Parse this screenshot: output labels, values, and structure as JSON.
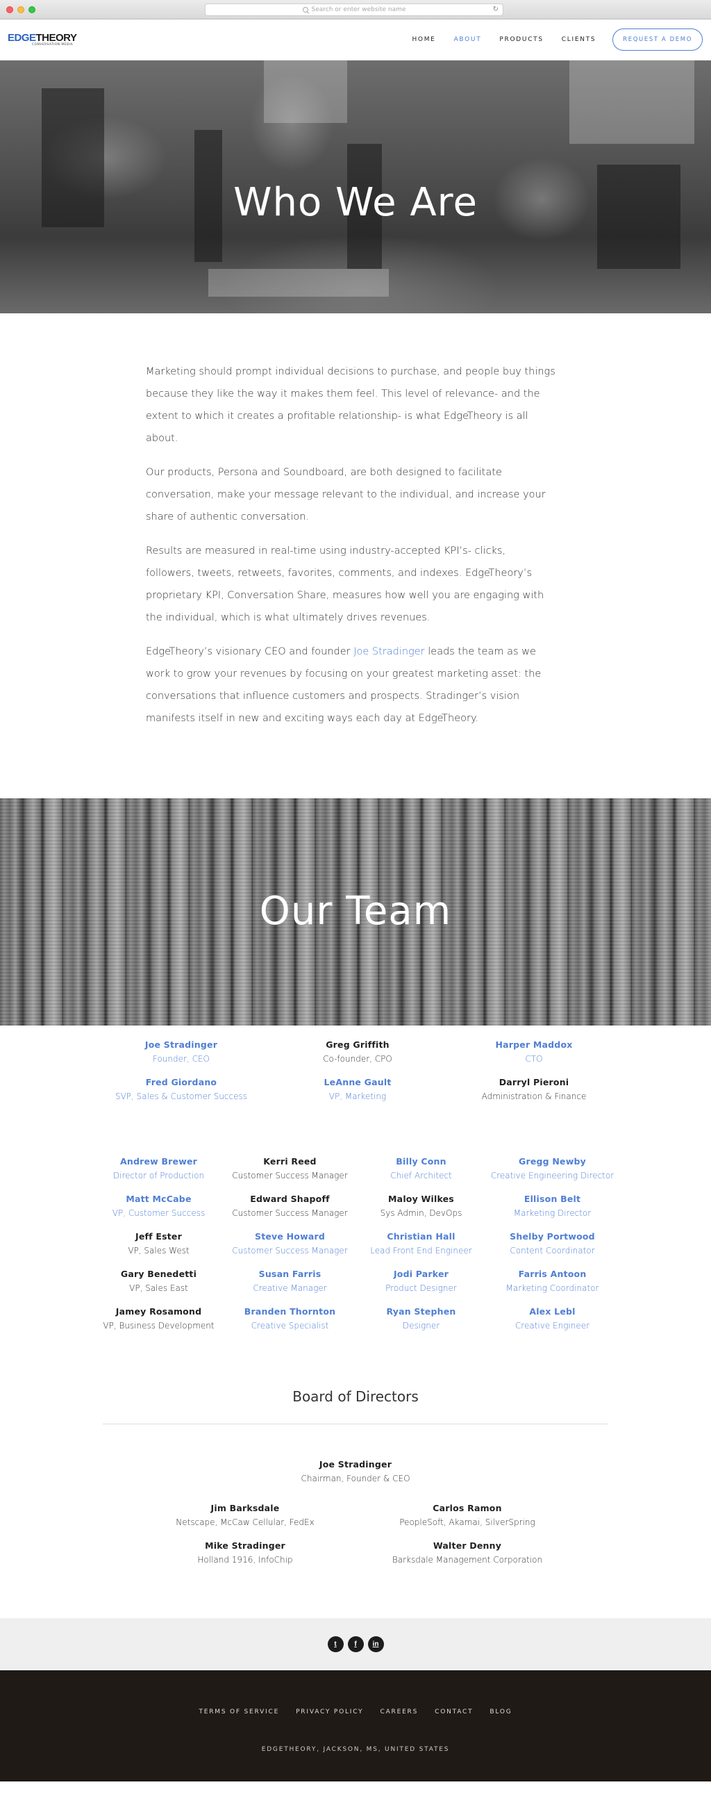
{
  "browser": {
    "url_placeholder": "Search or enter website name"
  },
  "header": {
    "logo_edge": "EDGE",
    "logo_theory": "THEORY",
    "logo_tagline": "CONVERSATION MEDIA",
    "nav": [
      {
        "label": "HOME"
      },
      {
        "label": "ABOUT"
      },
      {
        "label": "PRODUCTS"
      },
      {
        "label": "CLIENTS"
      }
    ],
    "cta": "REQUEST A DEMO"
  },
  "hero": {
    "title": "Who We Are"
  },
  "intro": {
    "p1": "Marketing should prompt individual decisions to purchase, and people buy things because they like the way it makes them feel. This level of relevance- and the extent to which it creates a profitable relationship- is what EdgeTheory is all about.",
    "p2": "Our products, Persona and Soundboard, are both designed to facilitate conversation, make your message relevant to the individual, and increase your share of authentic conversation.",
    "p3": "Results are measured in real-time using industry-accepted KPI’s- clicks, followers, tweets, retweets, favorites, comments, and indexes. EdgeTheory’s proprietary KPI, Conversation Share, measures how well you are engaging with the individual, which is what ultimately drives revenues.",
    "p4_before": "EdgeTheory’s visionary CEO and founder ",
    "p4_link": "Joe Stradinger",
    "p4_after": " leads the team as we work to grow your revenues by focusing on your greatest marketing asset: the conversations that influence customers and prospects. Stradinger’s vision manifests itself in new and exciting ways each day at EdgeTheory."
  },
  "team": {
    "title": "Our Team",
    "leaders": [
      {
        "name": "Joe Stradinger",
        "role": "Founder, CEO"
      },
      {
        "name": "Greg Griffith",
        "role": "Co-founder, CPO"
      },
      {
        "name": "Harper Maddox",
        "role": "CTO"
      },
      {
        "name": "Fred Giordano",
        "role": "SVP, Sales & Customer Success"
      },
      {
        "name": "LeAnne Gault",
        "role": "VP, Marketing"
      },
      {
        "name": "Darryl Pieroni",
        "role": "Administration & Finance"
      }
    ],
    "staff": [
      {
        "name": "Andrew Brewer",
        "role": "Director of Production"
      },
      {
        "name": "Kerri Reed",
        "role": "Customer Success Manager"
      },
      {
        "name": "Billy Conn",
        "role": "Chief Architect"
      },
      {
        "name": "Gregg Newby",
        "role": "Creative Engineering Director"
      },
      {
        "name": "Matt McCabe",
        "role": "VP, Customer Success"
      },
      {
        "name": "Edward Shapoff",
        "role": "Customer Success Manager"
      },
      {
        "name": "Maloy Wilkes",
        "role": "Sys Admin, DevOps"
      },
      {
        "name": "Ellison Belt",
        "role": "Marketing Director"
      },
      {
        "name": "Jeff Ester",
        "role": "VP, Sales West"
      },
      {
        "name": "Steve Howard",
        "role": "Customer Success Manager"
      },
      {
        "name": "Christian Hall",
        "role": "Lead Front End Engineer"
      },
      {
        "name": "Shelby Portwood",
        "role": "Content Coordinator"
      },
      {
        "name": "Gary Benedetti",
        "role": "VP, Sales East"
      },
      {
        "name": "Susan Farris",
        "role": "Creative Manager"
      },
      {
        "name": "Jodi Parker",
        "role": "Product Designer"
      },
      {
        "name": "Farris Antoon",
        "role": "Marketing Coordinator"
      },
      {
        "name": "Jamey Rosamond",
        "role": "VP, Business Development"
      },
      {
        "name": "Branden Thornton",
        "role": "Creative Specialist"
      },
      {
        "name": "Ryan Stephen",
        "role": "Designer"
      },
      {
        "name": "Alex Lebl",
        "role": "Creative Engineer"
      }
    ]
  },
  "board": {
    "title": "Board of Directors",
    "chair": {
      "name": "Joe Stradinger",
      "role": "Chairman, Founder & CEO"
    },
    "members": [
      {
        "name": "Jim Barksdale",
        "role": "Netscape, McCaw Cellular, FedEx"
      },
      {
        "name": "Carlos Ramon",
        "role": "PeopleSoft, Akamai, SilverSpring"
      },
      {
        "name": "Mike Stradinger",
        "role": "Holland 1916, InfoChip"
      },
      {
        "name": "Walter Denny",
        "role": "Barksdale Management Corporation"
      }
    ]
  },
  "social": [
    {
      "icon": "twitter-icon",
      "glyph": "t"
    },
    {
      "icon": "facebook-icon",
      "glyph": "f"
    },
    {
      "icon": "linkedin-icon",
      "glyph": "in"
    }
  ],
  "footer": {
    "links": [
      {
        "label": "TERMS OF SERVICE"
      },
      {
        "label": "PRIVACY POLICY"
      },
      {
        "label": "CAREERS"
      },
      {
        "label": "CONTACT"
      },
      {
        "label": "BLOG"
      }
    ],
    "address": "EDGETHEORY, JACKSON, MS, UNITED STATES"
  },
  "colors": {
    "accent": "#4f7fd4",
    "footer_bg": "#1f1a16",
    "social_bg": "#efefef"
  }
}
